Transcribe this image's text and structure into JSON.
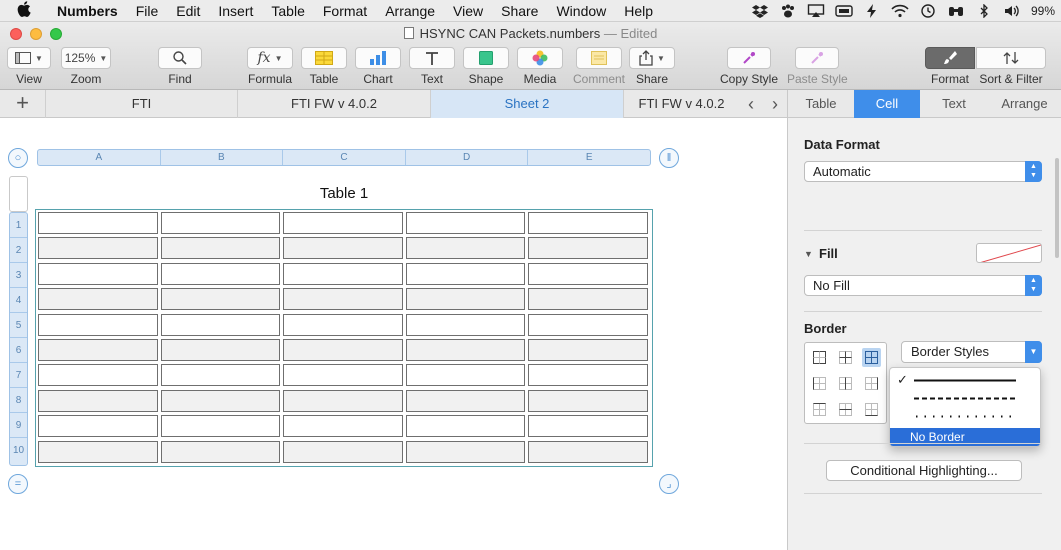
{
  "menubar": {
    "app_name": "Numbers",
    "items": [
      "File",
      "Edit",
      "Insert",
      "Table",
      "Format",
      "Arrange",
      "View",
      "Share",
      "Window",
      "Help"
    ],
    "battery": "99%"
  },
  "window": {
    "title": "HSYNC CAN Packets.numbers",
    "edited": "— Edited"
  },
  "toolbar": {
    "view": "View",
    "zoom_value": "125%",
    "zoom": "Zoom",
    "find": "Find",
    "formula": "Formula",
    "table": "Table",
    "chart": "Chart",
    "text": "Text",
    "shape": "Shape",
    "media": "Media",
    "comment": "Comment",
    "share": "Share",
    "copy_style": "Copy Style",
    "paste_style": "Paste Style",
    "format": "Format",
    "sort_filter": "Sort & Filter"
  },
  "sheet_tabs": [
    {
      "label": "FTI"
    },
    {
      "label": "FTI FW v 4.0.2"
    },
    {
      "label": "Sheet 2"
    },
    {
      "label": "FTI FW v 4.0.2"
    }
  ],
  "inspector_tabs": [
    {
      "label": "Table"
    },
    {
      "label": "Cell"
    },
    {
      "label": "Text"
    },
    {
      "label": "Arrange"
    }
  ],
  "table": {
    "title": "Table 1",
    "columns": [
      "A",
      "B",
      "C",
      "D",
      "E"
    ],
    "rows": [
      "1",
      "2",
      "3",
      "4",
      "5",
      "6",
      "7",
      "8",
      "9",
      "10"
    ]
  },
  "inspector": {
    "data_format_label": "Data Format",
    "data_format_value": "Automatic",
    "fill_label": "Fill",
    "fill_value": "No Fill",
    "border_label": "Border",
    "border_styles": "Border Styles",
    "style_menu_no_border": "No Border",
    "check_mark": "✓",
    "conditional": "Conditional Highlighting..."
  },
  "colors": {
    "accent": "#3f8eea",
    "menu_highlight": "#2a6ed8",
    "grid_border": "#56a2ad"
  }
}
